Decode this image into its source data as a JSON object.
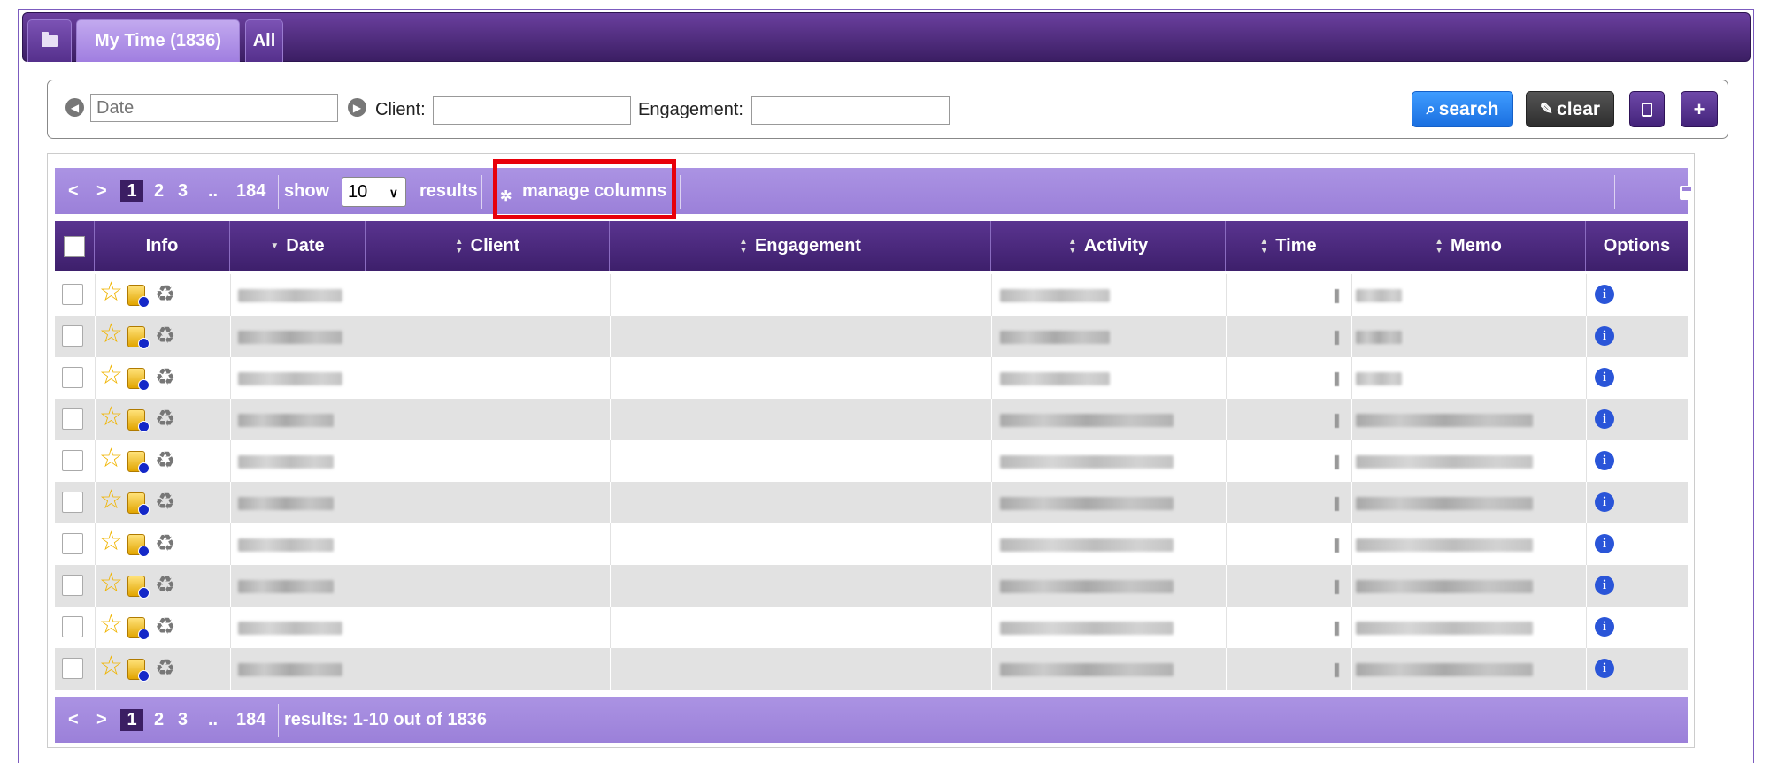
{
  "tabs": {
    "folder_icon": "folder-icon",
    "my_time": "My Time (1836)",
    "all": "All"
  },
  "filters": {
    "date_placeholder": "Date",
    "client_label": "Client:",
    "engagement_label": "Engagement:",
    "search_label": "search",
    "clear_label": "clear"
  },
  "pager": {
    "prev": "<",
    "next": ">",
    "pages": [
      "1",
      "2",
      "3"
    ],
    "ellipsis": "..",
    "last": "184",
    "show_label": "show",
    "page_size": "10",
    "results_label": "results",
    "manage_columns": "manage columns",
    "results_summary": "results: 1-10 out of 1836"
  },
  "table": {
    "columns": {
      "info": "Info",
      "date": "Date",
      "client": "Client",
      "engagement": "Engagement",
      "activity": "Activity",
      "time": "Time",
      "memo": "Memo",
      "options": "Options"
    },
    "row_count": 10
  },
  "colors": {
    "header_dark": "#3d1f6b",
    "pager_light": "#9b80d9",
    "search_blue": "#1a6fe0",
    "highlight_red": "#e8000b"
  }
}
